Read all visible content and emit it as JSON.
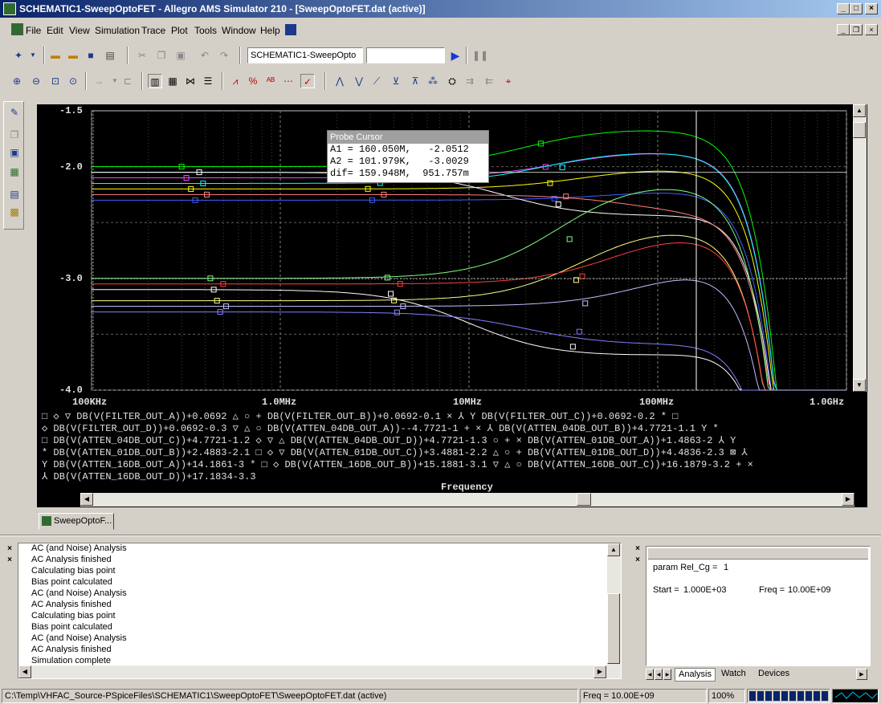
{
  "window": {
    "title": "SCHEMATIC1-SweepOptoFET - Allegro AMS Simulator 210 - [SweepOptoFET.dat (active)]"
  },
  "menu": [
    "File",
    "Edit",
    "View",
    "Simulation",
    "Trace",
    "Plot",
    "Tools",
    "Window",
    "Help"
  ],
  "toolbar": {
    "schematic_combo": "SCHEMATIC1-SweepOpto",
    "profile_value": ""
  },
  "probe_cursor": {
    "title": "Probe Cursor",
    "rows": [
      "A1 = 160.050M,   -2.0512",
      "A2 = 101.979K,   -3.0029",
      "dif= 159.948M,  951.757m"
    ]
  },
  "plot_tab": "SweepOptoF...",
  "output_log": [
    "AC (and Noise) Analysis",
    "AC Analysis finished",
    "Calculating bias point",
    "Bias point calculated",
    "AC (and Noise) Analysis",
    "AC Analysis finished",
    "Calculating bias point",
    "Bias point calculated",
    "AC (and Noise) Analysis",
    "AC Analysis finished",
    "Simulation complete"
  ],
  "watch": {
    "param": "param Rel_Cg =",
    "param_value": "1",
    "start_label": "Start =",
    "start_value": "1.000E+03",
    "freq_label": "Freq =",
    "freq_value": "10.00E+09"
  },
  "bottom_tabs": [
    "Analysis",
    "Watch",
    "Devices"
  ],
  "status": {
    "path": "C:\\Temp\\VHFAC_Source-PSpiceFiles\\SCHEMATIC1\\SweepOptoFET\\SweepOptoFET.dat (active)",
    "freq": "Freq = 10.00E+09",
    "zoom": "100%"
  },
  "chart_data": {
    "type": "line",
    "xlabel": "Frequency",
    "x_scale": "log",
    "x_ticks": [
      "100KHz",
      "1.0MHz",
      "10MHz",
      "100MHz",
      "1.0GHz"
    ],
    "y_ticks": [
      "-1.5",
      "-2.0",
      "-3.0",
      "-4.0"
    ],
    "xlim": [
      100000,
      1000000000
    ],
    "ylim": [
      -4.0,
      -1.5
    ],
    "grid": true,
    "background": "#000000",
    "legend_lines": [
      "□ ◇ ▽ DB(V(FILTER_OUT_A))+0.0692 △ ○ + DB(V(FILTER_OUT_B))+0.0692-0.1 × ⅄ Y DB(V(FILTER_OUT_C))+0.0692-0.2 * □",
      "◇ DB(V(FILTER_OUT_D))+0.0692-0.3 ▽ △ ○ DB(V(ATTEN_04DB_OUT_A))--4.7721-1 + × ⅄ DB(V(ATTEN_04DB_OUT_B))+4.7721-1.1 Y *",
      "□ DB(V(ATTEN_04DB_OUT_C))+4.7721-1.2 ◇ ▽ △ DB(V(ATTEN_04DB_OUT_D))+4.7721-1.3 ○ + × DB(V(ATTEN_01DB_OUT_A))+1.4863-2 ⅄ Y",
      "* DB(V(ATTEN_01DB_OUT_B))+2.4883-2.1 □ ◇ ▽ DB(V(ATTEN_01DB_OUT_C))+3.4881-2.2 △ ○ + DB(V(ATTEN_01DB_OUT_D))+4.4836-2.3 ⊠ ⅄",
      "Y DB(V(ATTEN_16DB_OUT_A))+14.1861-3 * □ ◇ DB(V(ATTEN_16DB_OUT_B))+15.1881-3.1 ▽ △ ○ DB(V(ATTEN_16DB_OUT_C))+16.1879-3.2 + ×",
      "⅄ DB(V(ATTEN_16DB_OUT_D))+17.1834-3.3"
    ],
    "series": [
      {
        "color": "#00ff00",
        "y0": -2.0,
        "fc": 20000000,
        "peak": 0.35
      },
      {
        "color": "#ff40ff",
        "y0": -2.1,
        "fc": 30000000,
        "peak": 0.25
      },
      {
        "color": "#ffff00",
        "y0": -2.2,
        "fc": 40000000,
        "peak": 0.2
      },
      {
        "color": "#4060ff",
        "y0": -2.3,
        "fc": 60000000,
        "peak": 0.1
      },
      {
        "color": "#ffffff",
        "y0": -2.05,
        "fc": 15000000,
        "peak": -0.4
      },
      {
        "color": "#00ffff",
        "y0": -2.15,
        "fc": 25000000,
        "peak": 0.3
      },
      {
        "color": "#ff8080",
        "y0": -2.25,
        "fc": 80000000,
        "peak": -0.2
      },
      {
        "color": "#80ff80",
        "y0": -3.0,
        "fc": 30000000,
        "peak": 0.9
      },
      {
        "color": "#ffffff",
        "y0": -3.1,
        "fc": 10000000,
        "peak": -0.6
      },
      {
        "color": "#ffff80",
        "y0": -3.2,
        "fc": 40000000,
        "peak": 0.7
      },
      {
        "color": "#8080ff",
        "y0": -3.3,
        "fc": 20000000,
        "peak": -0.3
      },
      {
        "color": "#ff4040",
        "y0": -3.05,
        "fc": 60000000,
        "peak": 0.5
      },
      {
        "color": "#c0c0ff",
        "y0": -3.25,
        "fc": 90000000,
        "peak": 0.4
      }
    ]
  }
}
